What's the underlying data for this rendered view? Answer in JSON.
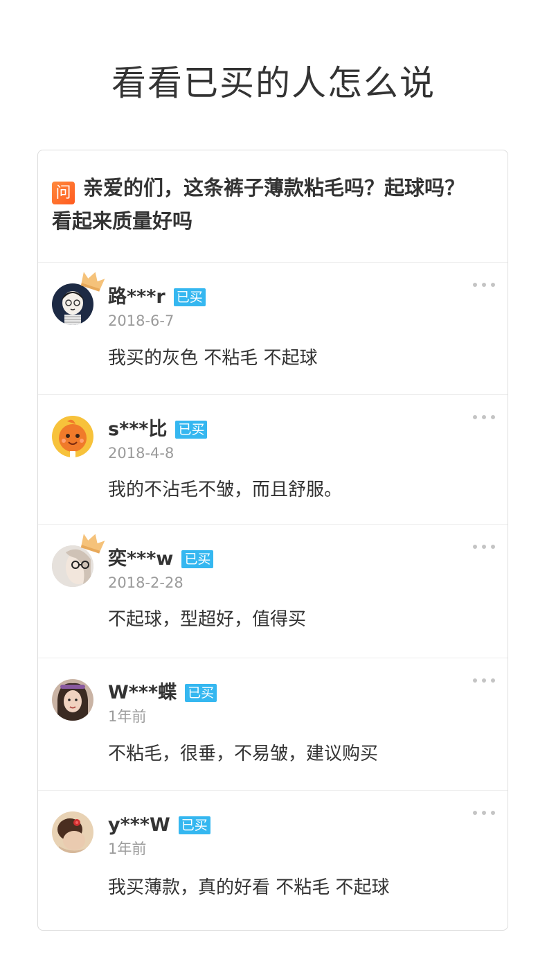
{
  "page": {
    "title": "看看已买的人怎么说"
  },
  "question": {
    "badge": "问",
    "text": "亲爱的们，这条裤子薄款粘毛吗？起球吗？看起来质量好吗",
    "badge_color": "#ff6a2b"
  },
  "answers": [
    {
      "username": "路***r",
      "tag": "已买",
      "date": "2018-6-7",
      "comment": "我买的灰色 不粘毛 不起球",
      "crown": true,
      "avatar_icon": "cartoon-girl-avatar"
    },
    {
      "username": "s***比",
      "tag": "已买",
      "date": "2018-4-8",
      "comment": "我的不沾毛不皱，而且舒服。",
      "crown": false,
      "avatar_icon": "orange-cartoon-avatar"
    },
    {
      "username": "奕***w",
      "tag": "已买",
      "date": "2018-2-28",
      "comment": "不起球，型超好，值得买",
      "crown": true,
      "avatar_icon": "glasses-avatar"
    },
    {
      "username": "W***蝶",
      "tag": "已买",
      "date": "1年前",
      "comment": "不粘毛，很垂，不易皱，建议购买",
      "crown": false,
      "avatar_icon": "photo-girl-avatar"
    },
    {
      "username": "y***W",
      "tag": "已买",
      "date": "1年前",
      "comment": "我买薄款，真的好看 不粘毛 不起球",
      "crown": false,
      "avatar_icon": "flower-hair-avatar"
    }
  ],
  "colors": {
    "tag_bg": "#35b7f0",
    "date_text": "#9b9b9b",
    "crown": "#f5c27a"
  }
}
